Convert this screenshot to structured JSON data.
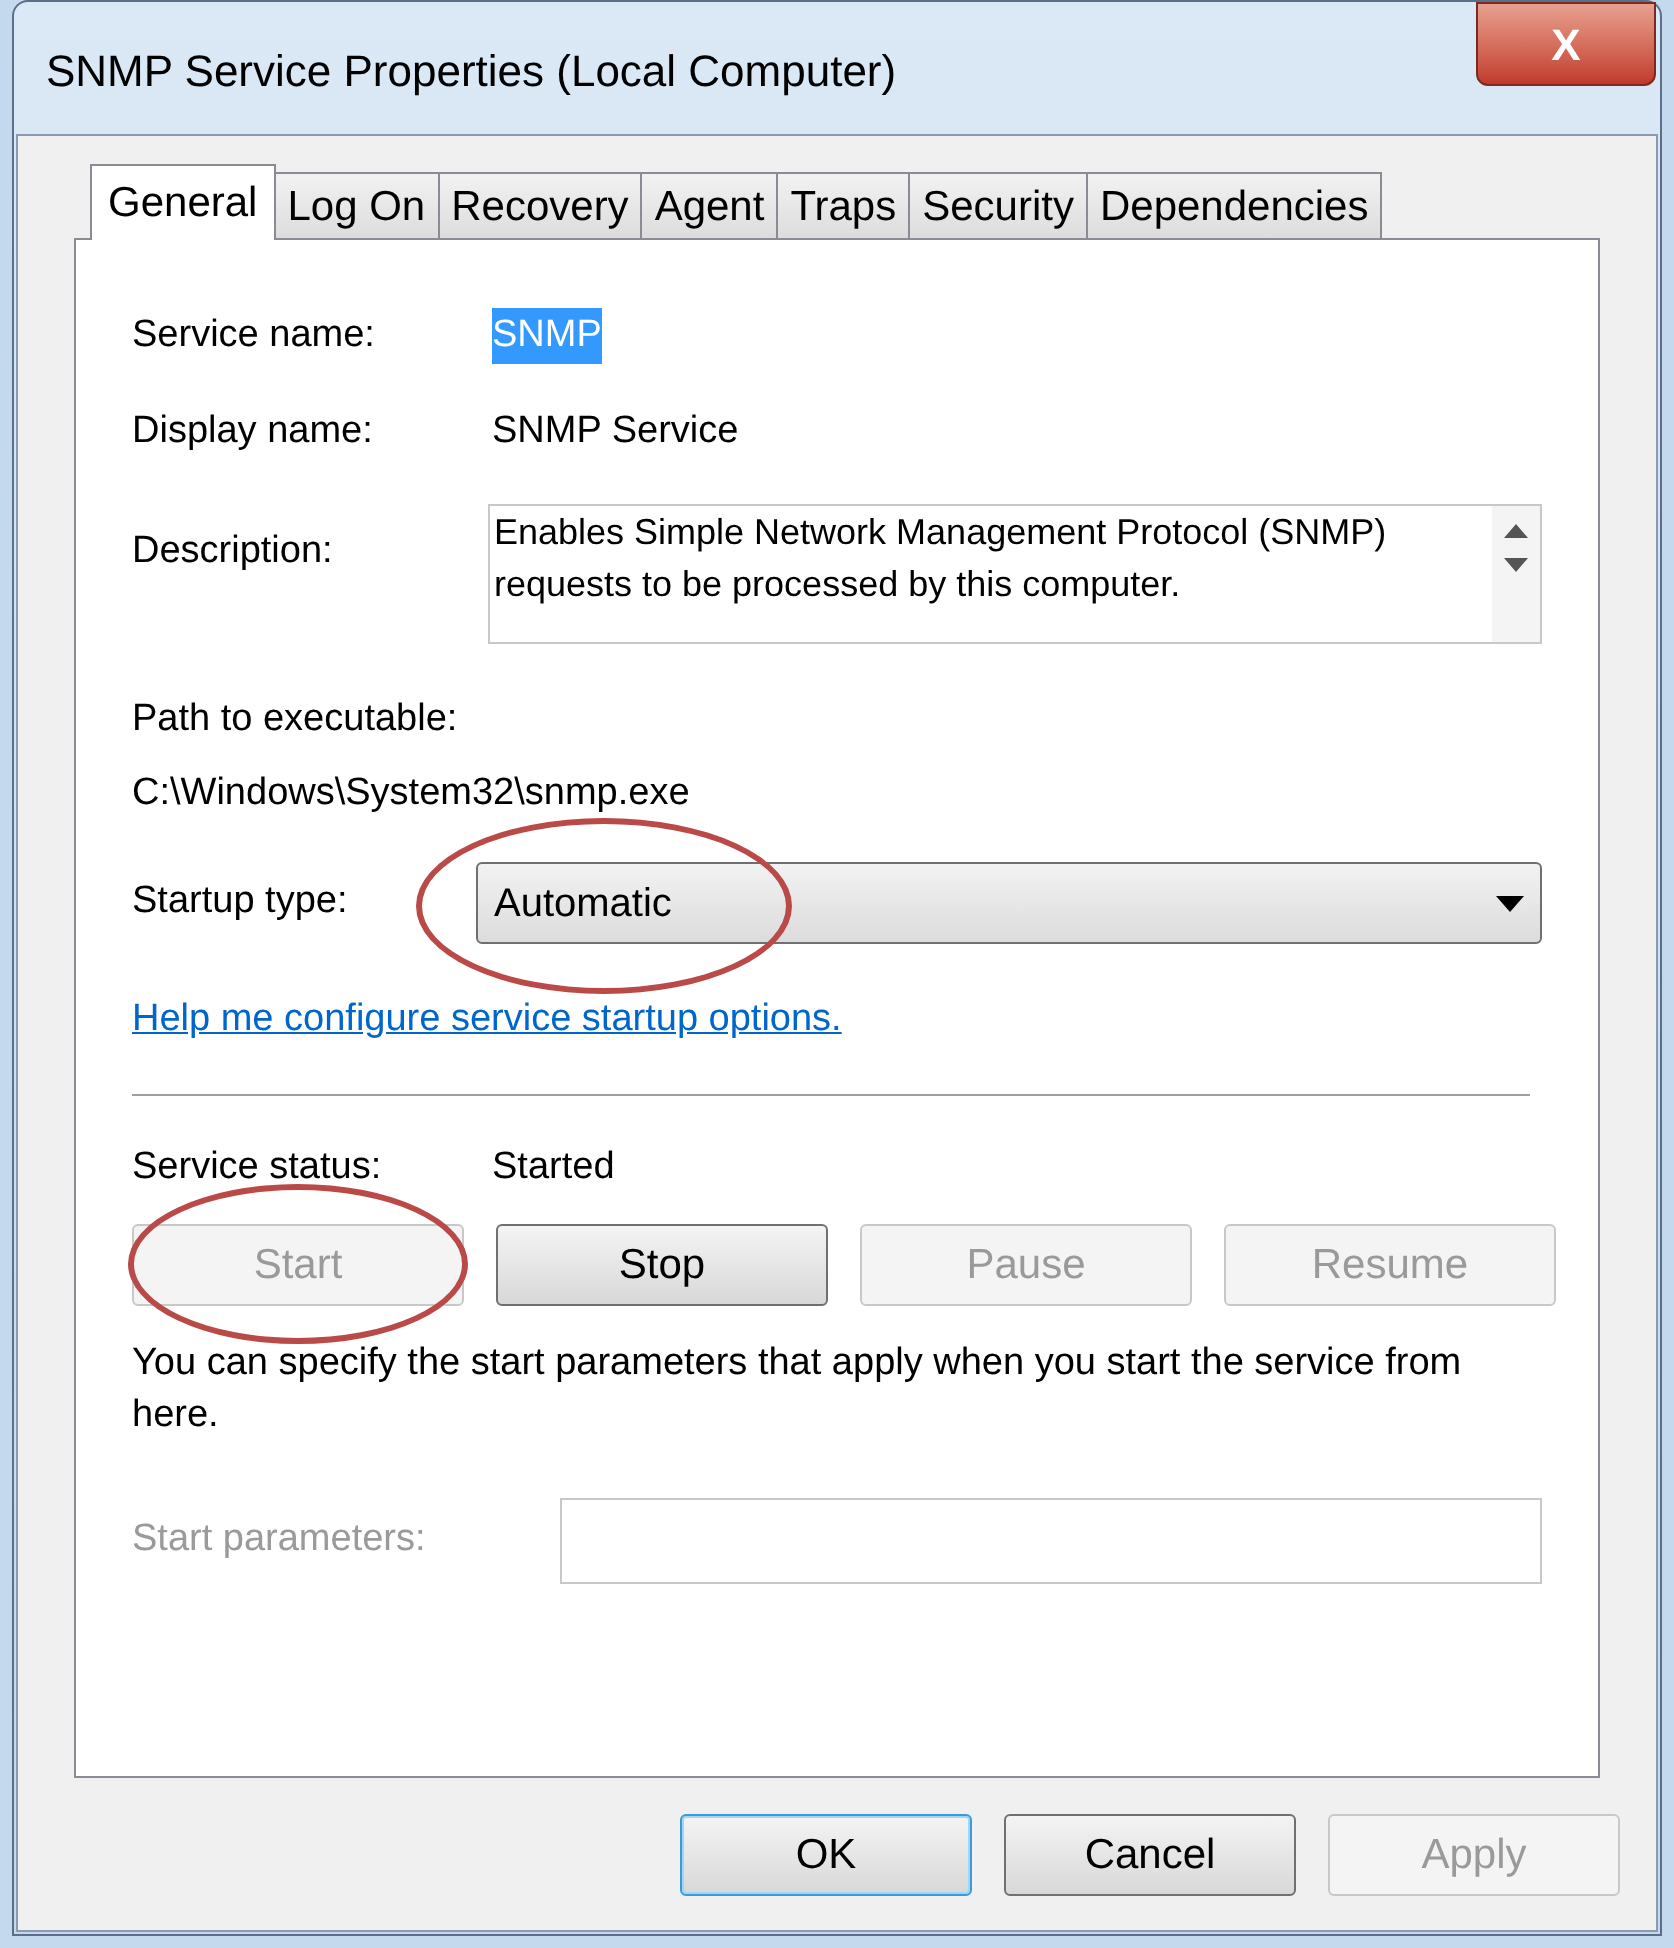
{
  "window": {
    "title": "SNMP Service Properties (Local Computer)",
    "close": "X"
  },
  "tabs": [
    {
      "label": "General",
      "selected": true
    },
    {
      "label": "Log On",
      "selected": false
    },
    {
      "label": "Recovery",
      "selected": false
    },
    {
      "label": "Agent",
      "selected": false
    },
    {
      "label": "Traps",
      "selected": false
    },
    {
      "label": "Security",
      "selected": false
    },
    {
      "label": "Dependencies",
      "selected": false
    }
  ],
  "service_name": {
    "label": "Service name:",
    "value": "SNMP",
    "selected": true
  },
  "display_name": {
    "label": "Display name:",
    "value": "SNMP Service"
  },
  "description": {
    "label": "Description:",
    "value": "Enables Simple Network Management Protocol (SNMP) requests to be processed by this computer."
  },
  "path": {
    "label": "Path to executable:",
    "value": "C:\\Windows\\System32\\snmp.exe"
  },
  "startup_type": {
    "label": "Startup type:",
    "value": "Automatic",
    "annotated": true
  },
  "help_link": "Help me configure service startup options.",
  "service_status": {
    "label": "Service status:",
    "value": "Started"
  },
  "service_buttons": [
    {
      "label": "Start",
      "disabled": true,
      "annotated": true
    },
    {
      "label": "Stop",
      "disabled": false,
      "annotated": false
    },
    {
      "label": "Pause",
      "disabled": true,
      "annotated": false
    },
    {
      "label": "Resume",
      "disabled": true,
      "annotated": false
    }
  ],
  "info_text": "You can specify the start parameters that apply when you start the service from here.",
  "start_parameters": {
    "label": "Start parameters:",
    "disabled": true
  },
  "dialog_buttons": [
    {
      "label": "OK",
      "disabled": false,
      "default": true
    },
    {
      "label": "Cancel",
      "disabled": false,
      "default": false
    },
    {
      "label": "Apply",
      "disabled": true,
      "default": false
    }
  ]
}
